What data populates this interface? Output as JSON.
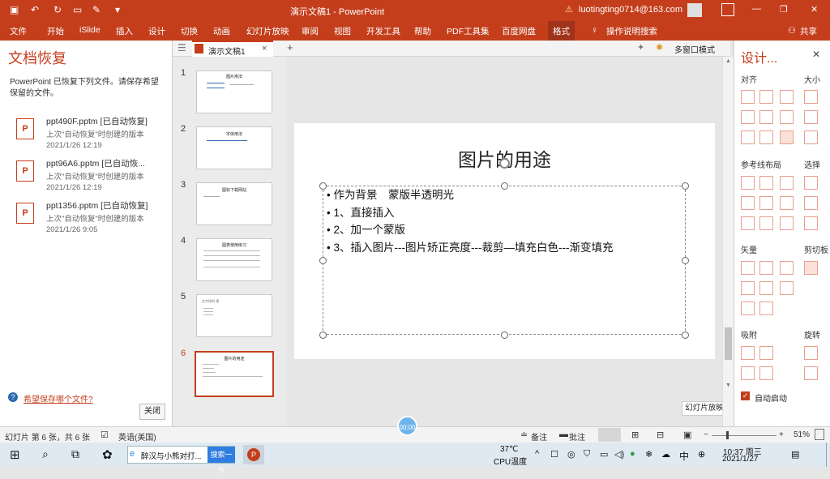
{
  "titlebar": {
    "doc_title": "演示文稿1 - PowerPoint",
    "user": "luotingting0714@163.com",
    "minimize": "—",
    "restore": "❐",
    "maximize": "▢",
    "close": "✕",
    "warn": "⚠"
  },
  "menu": {
    "items": [
      "文件",
      "开始",
      "iSlide",
      "插入",
      "设计",
      "切换",
      "动画",
      "幻灯片放映",
      "审阅",
      "视图",
      "开发工具",
      "帮助",
      "PDF工具集",
      "百度网盘",
      "格式"
    ],
    "search": "操作说明搜索",
    "share": "共享"
  },
  "recovery": {
    "title": "文档恢复",
    "message": "PowerPoint 已恢复下列文件。请保存希望保留的文件。",
    "files": [
      {
        "name": "ppt490F.pptm  [已自动恢复]",
        "desc": "上次\"自动恢复\"时创建的版本",
        "time": "2021/1/26 12:19"
      },
      {
        "name": "ppt96A6.pptm  [已自动恢...",
        "desc": "上次\"自动恢复\"时创建的版本",
        "time": "2021/1/26 12:19"
      },
      {
        "name": "ppt1356.pptm  [已自动恢复]",
        "desc": "上次\"自动恢复\"时创建的版本",
        "time": "2021/1/26 9:05"
      }
    ],
    "help_link": "希望保存哪个文件?",
    "close_button": "关闭",
    "ppt_letter": "P",
    "help_mark": "?"
  },
  "tab": {
    "label": "演示文稿1",
    "close": "×",
    "add": "+",
    "multiwindow": "多窗口模式"
  },
  "thumbnails": [
    {
      "num": "1",
      "title": "图片用法"
    },
    {
      "num": "2",
      "title": "字体用法"
    },
    {
      "num": "3",
      "title": "图标下载网站"
    },
    {
      "num": "4",
      "title": "图表使用练习"
    },
    {
      "num": "5",
      "title": "文字排列 演"
    },
    {
      "num": "6",
      "title": "图片的用途"
    }
  ],
  "slide": {
    "title": "图片的用途",
    "bullets": [
      "• 作为背景　蒙版半透明光",
      "• 1、直接插入",
      "• 2、加一个蒙版",
      "• 3、插入图片---图片矫正亮度---裁剪—填充白色---渐变填充"
    ]
  },
  "design": {
    "title": "设计...",
    "close": "✕",
    "align": "对齐",
    "size": "大小",
    "guides": "参考线布局",
    "select": "选择",
    "vector": "矢量",
    "clipboard": "剪切板",
    "snap": "吸附",
    "rotate": "旋转",
    "auto_start": "自动启动",
    "check": "✓"
  },
  "tooltip": "幻灯片放映",
  "status": {
    "slide_count": "幻灯片 第 6 张，共 6 张",
    "language": "英语(美国)",
    "notes": "备注",
    "comments": "批注",
    "zoom": "51%",
    "timer": "00:00",
    "minus": "−",
    "plus": "+"
  },
  "taskbar": {
    "search_item": "醉汉与小熊对打...",
    "search_button": "搜索一下",
    "temperature": "37℃",
    "cpu": "CPU温度",
    "ime": "中",
    "time": "10:37 周三",
    "date": "2021/1/27"
  }
}
